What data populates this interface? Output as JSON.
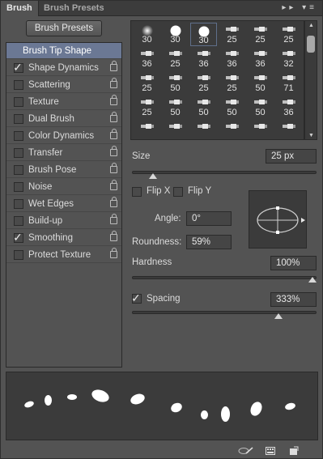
{
  "tabs": {
    "brush": "Brush",
    "presets": "Brush Presets"
  },
  "header_icons": {
    "collapse": "▸▸",
    "menu": "▾≡"
  },
  "presets_button": "Brush Presets",
  "options": [
    {
      "label": "Brush Tip Shape",
      "checked": null,
      "selected": true,
      "lock": false
    },
    {
      "label": "Shape Dynamics",
      "checked": true,
      "selected": false,
      "lock": true
    },
    {
      "label": "Scattering",
      "checked": false,
      "selected": false,
      "lock": true
    },
    {
      "label": "Texture",
      "checked": false,
      "selected": false,
      "lock": true
    },
    {
      "label": "Dual Brush",
      "checked": false,
      "selected": false,
      "lock": true
    },
    {
      "label": "Color Dynamics",
      "checked": false,
      "selected": false,
      "lock": true
    },
    {
      "label": "Transfer",
      "checked": false,
      "selected": false,
      "lock": true
    },
    {
      "label": "Brush Pose",
      "checked": false,
      "selected": false,
      "lock": true
    },
    {
      "label": "Noise",
      "checked": false,
      "selected": false,
      "lock": true
    },
    {
      "label": "Wet Edges",
      "checked": false,
      "selected": false,
      "lock": true
    },
    {
      "label": "Build-up",
      "checked": false,
      "selected": false,
      "lock": true
    },
    {
      "label": "Smoothing",
      "checked": true,
      "selected": false,
      "lock": true
    },
    {
      "label": "Protect Texture",
      "checked": false,
      "selected": false,
      "lock": true
    }
  ],
  "presets": [
    {
      "n": "30",
      "t": "soft"
    },
    {
      "n": "30",
      "t": "hard"
    },
    {
      "n": "30",
      "t": "hard",
      "sel": true
    },
    {
      "n": "25",
      "t": "tip"
    },
    {
      "n": "25",
      "t": "tip"
    },
    {
      "n": "25",
      "t": "tip"
    },
    {
      "n": "36",
      "t": "tip"
    },
    {
      "n": "25",
      "t": "tip"
    },
    {
      "n": "36",
      "t": "tip"
    },
    {
      "n": "36",
      "t": "tip"
    },
    {
      "n": "36",
      "t": "tip"
    },
    {
      "n": "32",
      "t": "tip"
    },
    {
      "n": "25",
      "t": "tip"
    },
    {
      "n": "50",
      "t": "tip"
    },
    {
      "n": "25",
      "t": "tip"
    },
    {
      "n": "25",
      "t": "tip"
    },
    {
      "n": "50",
      "t": "tip"
    },
    {
      "n": "71",
      "t": "tip"
    },
    {
      "n": "25",
      "t": "tip"
    },
    {
      "n": "50",
      "t": "tip"
    },
    {
      "n": "50",
      "t": "tip"
    },
    {
      "n": "50",
      "t": "tip"
    },
    {
      "n": "50",
      "t": "tip"
    },
    {
      "n": "36",
      "t": "tip"
    },
    {
      "n": "",
      "t": "tip"
    },
    {
      "n": "",
      "t": "tip"
    },
    {
      "n": "",
      "t": "tip"
    },
    {
      "n": "",
      "t": "tip"
    },
    {
      "n": "",
      "t": "tip"
    },
    {
      "n": "",
      "t": "tip"
    }
  ],
  "size": {
    "label": "Size",
    "value": "25 px",
    "level": 0.15
  },
  "flip_x": {
    "label": "Flip X",
    "checked": false
  },
  "flip_y": {
    "label": "Flip Y",
    "checked": false
  },
  "angle": {
    "label": "Angle:",
    "value": "0°"
  },
  "roundness": {
    "label": "Roundness:",
    "value": "59%"
  },
  "hardness": {
    "label": "Hardness",
    "value": "100%",
    "level": 1.0
  },
  "spacing": {
    "label": "Spacing",
    "value": "333%",
    "checked": true,
    "level": 0.77
  },
  "colors": {
    "panel": "#535353",
    "selection": "#6b7894",
    "well": "#3b3b3b"
  }
}
